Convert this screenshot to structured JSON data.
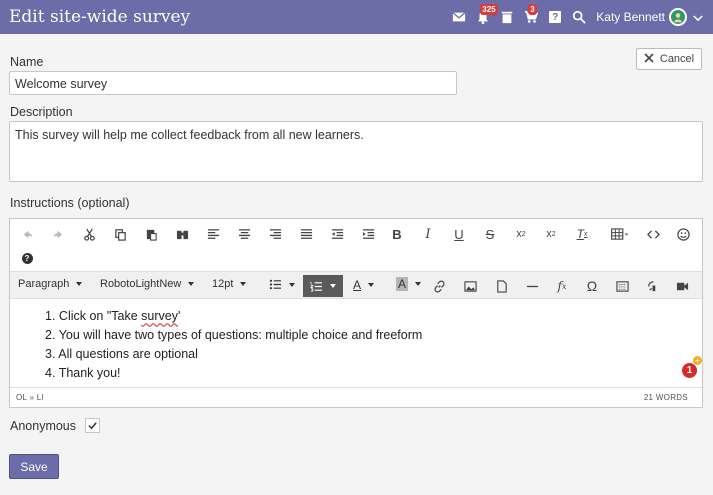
{
  "header": {
    "title": "Edit site-wide survey",
    "notifications_badge": "325",
    "cart_badge": "3",
    "help_label": "?",
    "user_name": "Katy Bennett",
    "accent_color": "#6b6ca8"
  },
  "form": {
    "cancel_label": "Cancel",
    "name_label": "Name",
    "name_value": "Welcome survey",
    "description_label": "Description",
    "description_value": "This survey will help me collect feedback from all new learners.",
    "instructions_label": "Instructions (optional)",
    "anonymous_label": "Anonymous",
    "anonymous_checked": true,
    "save_label": "Save"
  },
  "editor": {
    "paragraph_select": "Paragraph",
    "font_select": "RobotoLightNew",
    "size_select": "12pt",
    "text_color_label": "A",
    "bg_color_label": "A",
    "help_label": "?",
    "list": [
      "Click on \"Take ",
      "survey",
      "'",
      "You will have two types of questions: multiple choice and freeform",
      "All questions are optional",
      "Thank you!"
    ],
    "list_numbers": [
      "1.",
      "2.",
      "3.",
      "4."
    ],
    "status_path": "OL » LI",
    "word_count": "21 WORDS",
    "notification_count": "1",
    "notification_plus": "+"
  }
}
